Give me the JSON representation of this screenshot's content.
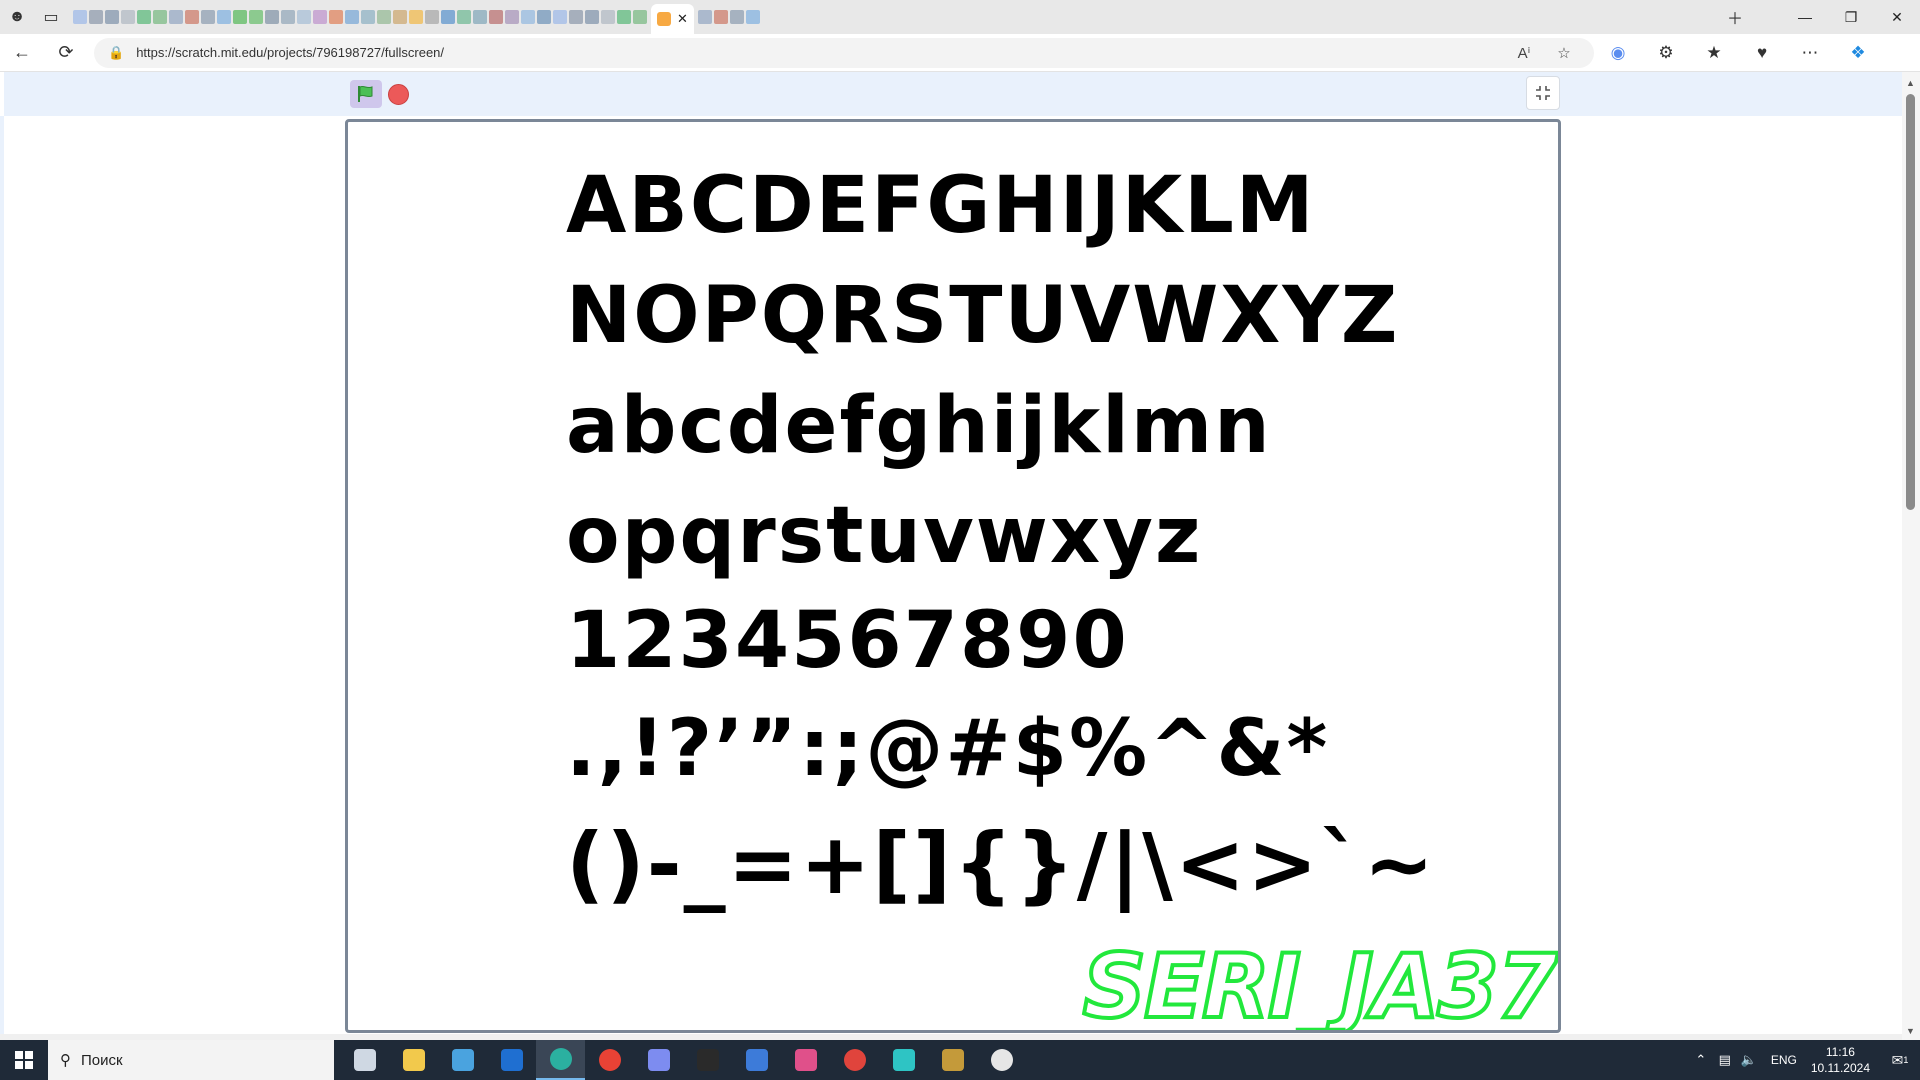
{
  "browser": {
    "url": "https://scratch.mit.edu/projects/796198727/fullscreen/",
    "tab_colors": [
      "#a8c0e8",
      "#9aa5b4",
      "#8fa0b4",
      "#b8c0c8",
      "#6fbf8a",
      "#88c090",
      "#a0b0c8",
      "#d08a7a",
      "#9aa8b8",
      "#8fb8e0",
      "#6cc070",
      "#7bc47f",
      "#90a0b0",
      "#9fb0c0",
      "#b0c4d8",
      "#c4a0d0",
      "#e09070",
      "#88b0d8",
      "#9ab8c8",
      "#a0c0a0",
      "#d0b080",
      "#f0c060",
      "#b0b0b0",
      "#70a0d0",
      "#80c0a0",
      "#90b0c0",
      "#c08080",
      "#b0a0c0",
      "#a0c0e0",
      "#80a0c0"
    ]
  },
  "player": {
    "glyph_lines": [
      "ABCDEFGHIJKLM",
      "NOPQRSTUVWXYZ",
      "abcdefghijklmn",
      "opqrstuvwxyz",
      "1234567890",
      ".,!?’”:;@#$%^&*",
      "()-_=+[]{}/|\\<>`~"
    ],
    "watermark": "SERI_JA37"
  },
  "taskbar": {
    "search_placeholder": "Поиск",
    "apps": [
      {
        "name": "task-view",
        "color": "#cfd8e3"
      },
      {
        "name": "file-explorer",
        "color": "#f2c94c"
      },
      {
        "name": "microsoft-store",
        "color": "#4aa3df"
      },
      {
        "name": "outlook",
        "color": "#1f6fd1"
      },
      {
        "name": "edge",
        "color": "#2bb0a0"
      },
      {
        "name": "chrome",
        "color": "#e94235"
      },
      {
        "name": "app-a",
        "color": "#7d8cf0"
      },
      {
        "name": "app-f",
        "color": "#2a2a2a"
      },
      {
        "name": "app-doc",
        "color": "#3d7bd9"
      },
      {
        "name": "app-drop",
        "color": "#e0508a"
      },
      {
        "name": "app-rec",
        "color": "#e0443c"
      },
      {
        "name": "app-x",
        "color": "#2ec4c4"
      },
      {
        "name": "app-lock",
        "color": "#c49a3a"
      },
      {
        "name": "app-play",
        "color": "#e6e6e6"
      }
    ],
    "language": "ENG",
    "time": "11:16",
    "date": "10.11.2024",
    "notification_count": "1"
  }
}
